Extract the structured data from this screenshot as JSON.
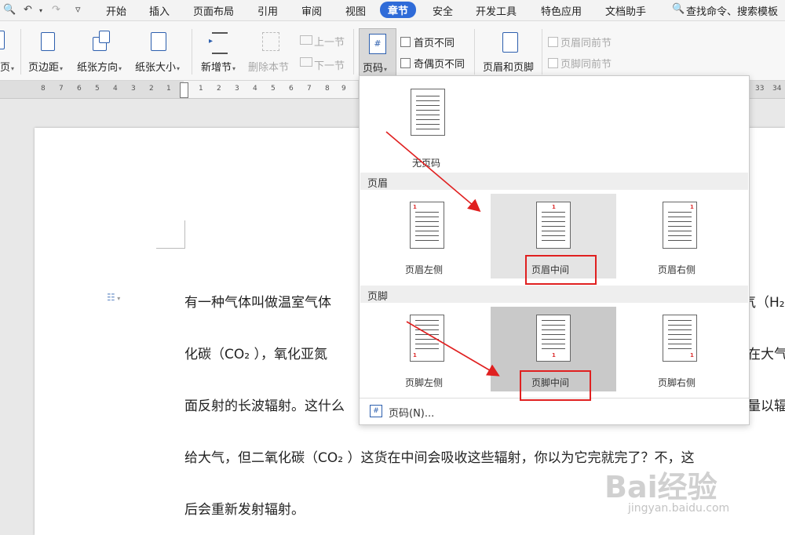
{
  "menubar": {
    "items": [
      "开始",
      "插入",
      "页面布局",
      "引用",
      "审阅",
      "视图",
      "章节",
      "安全",
      "开发工具",
      "特色应用",
      "文档助手"
    ],
    "active": "章节",
    "search_text": "查找命令、搜索模板"
  },
  "ribbon": {
    "page_partial": "页",
    "page_margin": "页边距",
    "orientation": "纸张方向",
    "paper_size": "纸张大小",
    "new_section": "新增节",
    "delete_section": "删除本节",
    "prev_section": "上一节",
    "next_section": "下一节",
    "page_number": "页码",
    "first_page_diff": "首页不同",
    "odd_even_diff": "奇偶页不同",
    "header_footer": "页眉和页脚",
    "header_same_prev": "页眉同前节",
    "footer_same_prev": "页脚同前节"
  },
  "ruler": {
    "ticks_left": [
      "8",
      "7",
      "6",
      "5",
      "4",
      "3",
      "2",
      "1"
    ],
    "ticks_right": [
      "1",
      "2",
      "3",
      "4",
      "5",
      "6",
      "7",
      "8",
      "9",
      "10"
    ],
    "ticks_far": [
      "33",
      "34"
    ]
  },
  "document": {
    "lines": [
      "有一种气体叫做温室气体",
      "化碳（CO₂ ），氧化亚氮",
      "面反射的长波辐射。这什么",
      "给大气，但二氧化碳（CO₂ ）这货在中间会吸收这些辐射，你以为它完就完了？不，这",
      "后会重新发射辐射。"
    ],
    "right_fragments": [
      "气（H₂",
      "在大气",
      "量以辐"
    ]
  },
  "dropdown": {
    "no_page_number": "无页码",
    "header_section": "页眉",
    "header_options": [
      "页眉左侧",
      "页眉中间",
      "页眉右侧"
    ],
    "footer_section": "页脚",
    "footer_options": [
      "页脚左侧",
      "页脚中间",
      "页脚右侧"
    ],
    "thumb_number": "1",
    "page_number_dialog": "页码(N)..."
  },
  "watermark": {
    "brand": "Bai经验",
    "url": "jingyan.baidu.com"
  },
  "colors": {
    "accent": "#2f6bd8",
    "annotation_red": "#e02020",
    "hover_gray": "#e4e4e4",
    "selected_gray": "#c9c9c9"
  }
}
